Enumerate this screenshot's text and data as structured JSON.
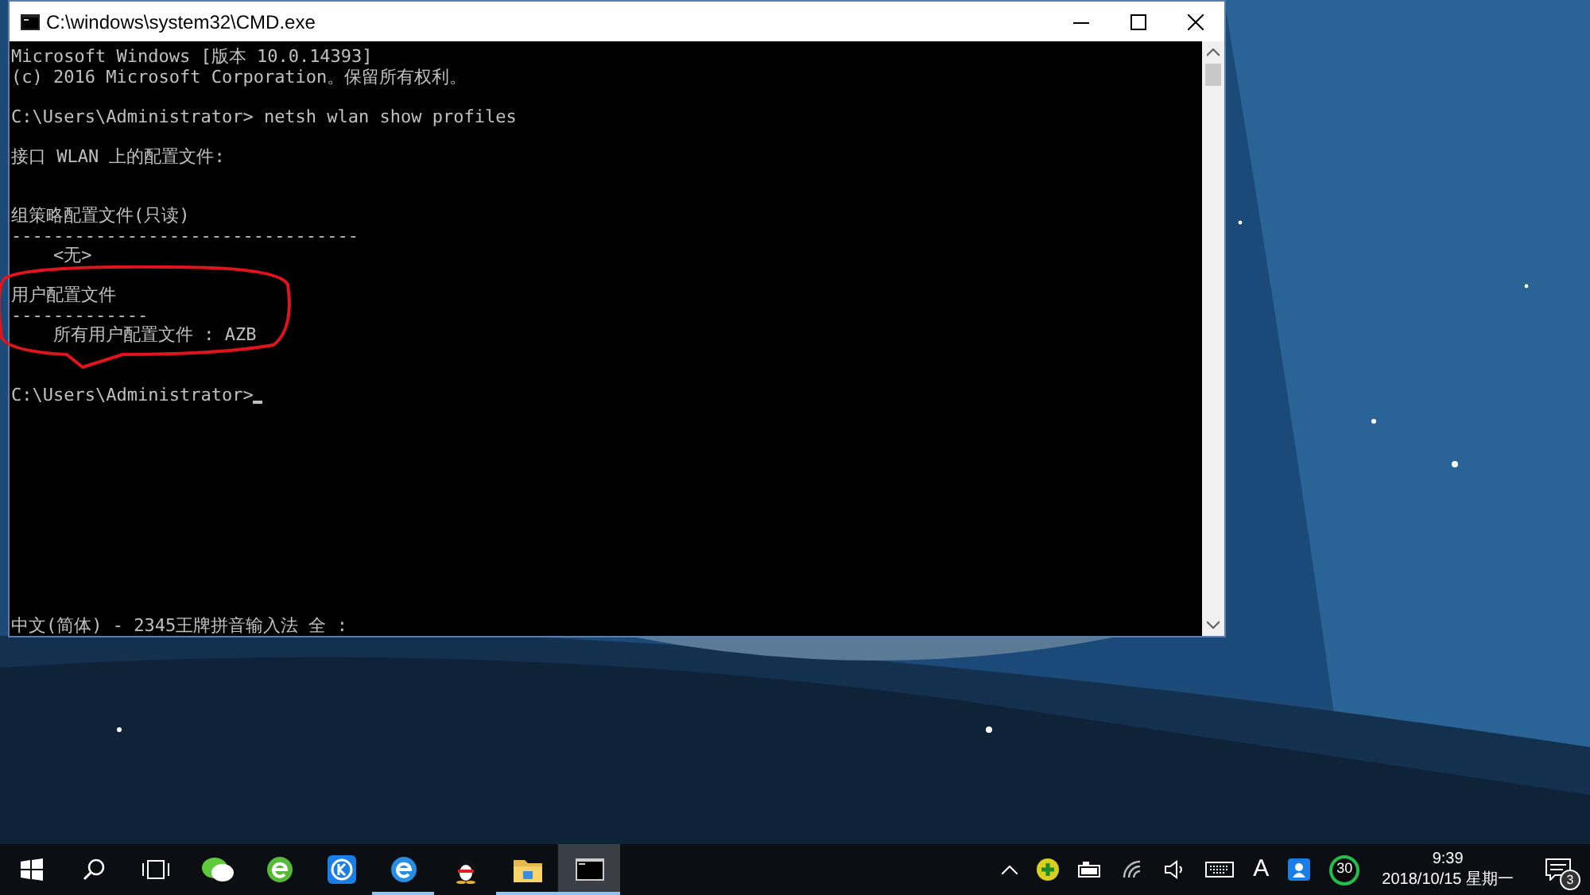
{
  "window": {
    "title": "C:\\windows\\system32\\CMD.exe"
  },
  "console": {
    "lines": [
      {
        "kind": "text",
        "text": "Microsoft Windows [版本 10.0.14393]"
      },
      {
        "kind": "text",
        "text": "(c) 2016 Microsoft Corporation。保留所有权利。"
      },
      {
        "kind": "blank"
      },
      {
        "kind": "text",
        "text": "C:\\Users\\Administrator> netsh wlan show profiles"
      },
      {
        "kind": "blank"
      },
      {
        "kind": "text",
        "text": "接口 WLAN 上的配置文件:"
      },
      {
        "kind": "blank"
      },
      {
        "kind": "blank"
      },
      {
        "kind": "text",
        "text": "组策略配置文件(只读)"
      },
      {
        "kind": "text",
        "text": "---------------------------------"
      },
      {
        "kind": "text",
        "text": "    <无>"
      },
      {
        "kind": "blank"
      },
      {
        "kind": "text",
        "text": "用户配置文件"
      },
      {
        "kind": "text",
        "text": "-------------"
      },
      {
        "kind": "text",
        "text": "    所有用户配置文件 : AZB"
      },
      {
        "kind": "blank"
      },
      {
        "kind": "blank"
      },
      {
        "kind": "prompt",
        "text": "C:\\Users\\Administrator>"
      }
    ],
    "ime_status": "中文(简体) - 2345王牌拼音输入法 全 :"
  },
  "taskbar": {
    "apps": [
      {
        "kind": "start",
        "selected": false,
        "running": false
      },
      {
        "kind": "search",
        "selected": false,
        "running": false
      },
      {
        "kind": "taskview",
        "selected": false,
        "running": false
      },
      {
        "kind": "chat",
        "selected": false,
        "running": false
      },
      {
        "kind": "browser-green",
        "selected": false,
        "running": false
      },
      {
        "kind": "k-app",
        "selected": false,
        "running": false
      },
      {
        "kind": "browser-blue",
        "selected": false,
        "running": true
      },
      {
        "kind": "penguin",
        "selected": false,
        "running": false
      },
      {
        "kind": "folder",
        "selected": false,
        "running": true
      },
      {
        "kind": "console",
        "selected": true,
        "running": true
      }
    ],
    "tray": {
      "ime_letter": "A",
      "badge": "30",
      "time": "9:39",
      "date": "2018/10/15 星期一",
      "notifications": "3"
    }
  }
}
